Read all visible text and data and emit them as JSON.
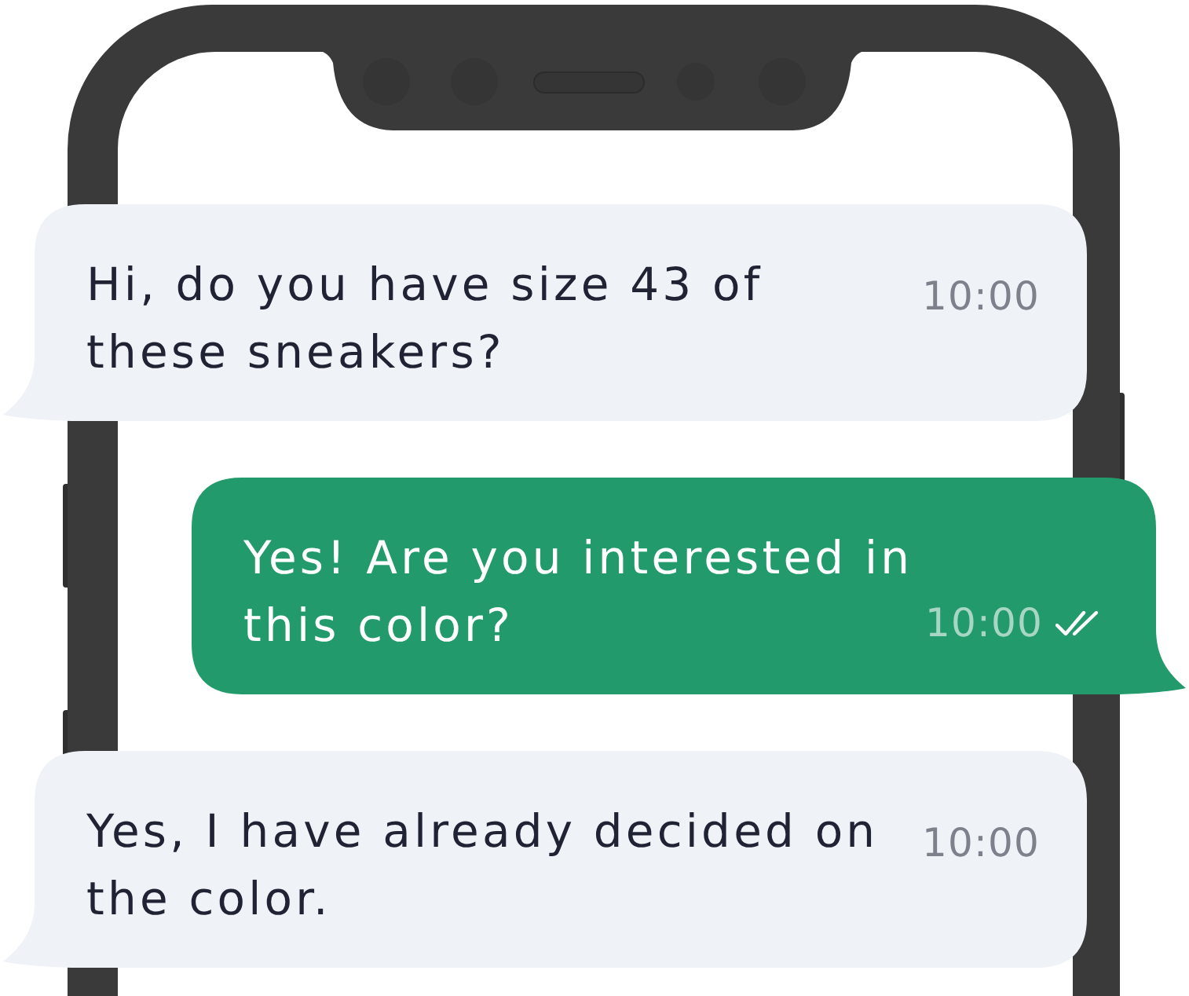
{
  "messages": [
    {
      "kind": "incoming",
      "text": "Hi, do you have size 43 of these sneakers?",
      "time": "10:00"
    },
    {
      "kind": "outgoing",
      "text": "Yes! Are you interested in this color?",
      "time": "10:00",
      "read": true
    },
    {
      "kind": "incoming",
      "text": "Yes, I have already decided on the color.",
      "time": "10:00"
    }
  ]
}
